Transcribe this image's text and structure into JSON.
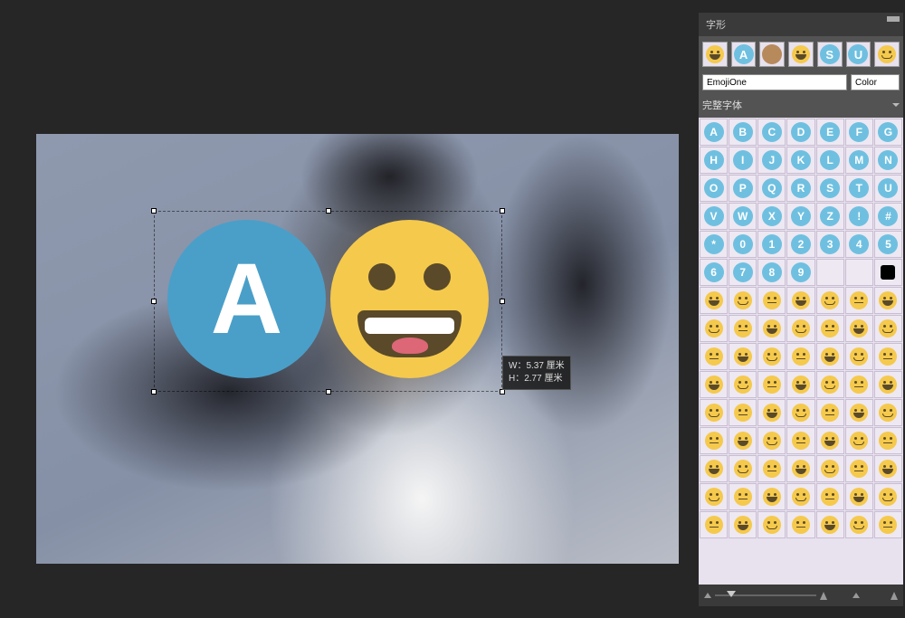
{
  "canvas": {
    "glyph_a_letter": "A",
    "dim_w_label": "W：5.37 厘米",
    "dim_h_label": "H：2.77 厘米"
  },
  "panel": {
    "tab_label": "字形",
    "menu_label": "≡▾",
    "font_input_value": "EmojiOne",
    "color_input_value": "Color",
    "subset_label": "完整字体",
    "recent": [
      {
        "type": "emoji",
        "name": "grin"
      },
      {
        "type": "letter",
        "char": "A"
      },
      {
        "type": "brown"
      },
      {
        "type": "emoji",
        "name": "shrug"
      },
      {
        "type": "letter",
        "char": "S"
      },
      {
        "type": "letter",
        "char": "U"
      },
      {
        "type": "emoji",
        "name": "blush"
      }
    ],
    "letter_rows": [
      [
        "A",
        "B",
        "C",
        "D",
        "E",
        "F",
        "G"
      ],
      [
        "H",
        "I",
        "J",
        "K",
        "L",
        "M",
        "N"
      ],
      [
        "O",
        "P",
        "Q",
        "R",
        "S",
        "T",
        "U"
      ],
      [
        "V",
        "W",
        "X",
        "Y",
        "Z",
        "!",
        "#"
      ],
      [
        "*",
        "0",
        "1",
        "2",
        "3",
        "4",
        "5"
      ]
    ],
    "num_tail": [
      "6",
      "7",
      "8",
      "9"
    ],
    "emoji_rows_count": 9,
    "emoji_per_row": 7
  }
}
